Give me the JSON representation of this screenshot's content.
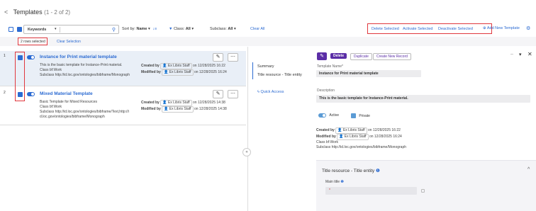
{
  "header": {
    "back_glyph": "<",
    "title": "Templates",
    "count": "(1 - 2 of 2)"
  },
  "toolbar": {
    "keywords_label": "Keywords",
    "sortby_label": "Sort by:",
    "sortby_value": "Name",
    "class_label": "Class:",
    "class_value": "All",
    "subclass_label": "Subclass:",
    "subclass_value": "All",
    "clear_all": "Clear All",
    "delete_selected": "Delete Selected",
    "activate_selected": "Activate Selected",
    "deactivate_selected": "Deactivate Selected",
    "add_new_template": "Add New Template"
  },
  "selection": {
    "rows_selected": "2 rows selected",
    "clear_selection": "Clear Selection"
  },
  "rows": [
    {
      "index": "1",
      "name": "Instance for Print material template",
      "description": "This is the basic template for Instance-Print material.",
      "class_line": "Class bf:Work",
      "subclass_line": "Subclass http://id.loc.gov/ontologies/bibframe/Monograph",
      "created_label": "Created by",
      "created_user": "Ex Libris Staff",
      "created_on": "on 12/28/2025 16:22",
      "modified_label": "Modified by",
      "modified_user": "Ex Libris Staff",
      "modified_on": "on 12/28/2025 16:24"
    },
    {
      "index": "2",
      "name": "Mixed Material Template",
      "description": "Basic Template for Mixed Resources",
      "class_line": "Class bf:Work",
      "subclass_line": "Subclass http://id.loc.gov/ontologies/bibframe/Text,http://i",
      "subclass_line2": "d.loc.gov/ontologies/bibframe/Monograph",
      "created_label": "Created by",
      "created_user": "Ex Libris Staff",
      "created_on": "on 12/28/2025 14:38",
      "modified_label": "Modified by",
      "modified_user": "Ex Libris Staff",
      "modified_on": "on 12/28/2025 14:38"
    }
  ],
  "detail_nav": {
    "summary": "Summary",
    "title_resource": "Title resource - Title entity",
    "quick_access": "Quick Access"
  },
  "detail": {
    "delete_btn": "Delete",
    "duplicate_btn": "Duplicate",
    "create_new_record_btn": "Create New Record",
    "template_name_label": "Template Name*",
    "template_name_value": "Instance for Print material template",
    "description_label": "Description",
    "description_value": "This is the basic template for Instance-Print material.",
    "active_label": "Active",
    "private_label": "Private",
    "created_label": "Created by",
    "created_user": "Ex Libris Staff",
    "created_on": "on 12/28/2025 16:22",
    "modified_label": "Modified by",
    "modified_user": "Ex Libris Staff",
    "modified_on": "on 12/28/2025 16:24",
    "class_line": "Class bf:Work",
    "subclass_line": "Subclass http://id.loc.gov/ontologies/bibframe/Monograph",
    "section_title": "Title resource - Title entity",
    "main_title_label": "Main title",
    "main_title_placeholder": "*"
  },
  "colors": {
    "accent": "#2c6bd2",
    "purple": "#5b2ea6",
    "highlight": "#e0383e"
  }
}
